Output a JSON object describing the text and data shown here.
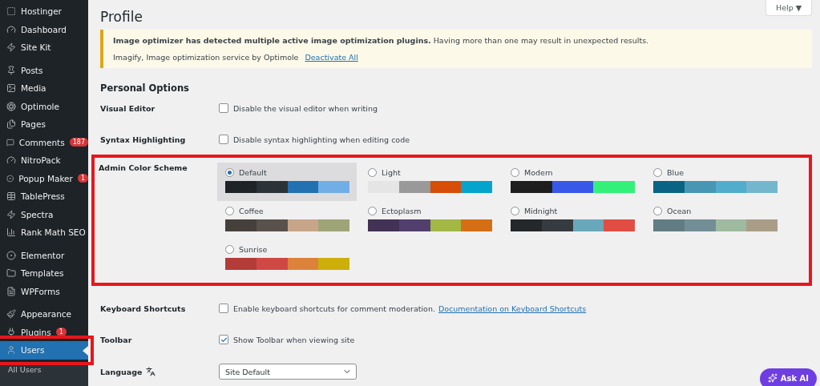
{
  "sidebar": {
    "groups": [
      {
        "items": [
          {
            "label": "Hostinger",
            "selected": false
          },
          {
            "label": "Dashboard",
            "selected": false
          },
          {
            "label": "Site Kit",
            "selected": false
          }
        ]
      },
      {
        "items": [
          {
            "label": "Posts",
            "selected": false
          },
          {
            "label": "Media",
            "selected": false
          },
          {
            "label": "Optimole",
            "selected": false
          },
          {
            "label": "Pages",
            "selected": false
          },
          {
            "label": "Comments",
            "badge": "187",
            "selected": false
          },
          {
            "label": "NitroPack",
            "selected": false
          },
          {
            "label": "Popup Maker",
            "badge": "1",
            "selected": false
          },
          {
            "label": "TablePress",
            "selected": false
          },
          {
            "label": "Spectra",
            "selected": false
          },
          {
            "label": "Rank Math SEO",
            "selected": false
          }
        ]
      },
      {
        "items": [
          {
            "label": "Elementor",
            "selected": false
          },
          {
            "label": "Templates",
            "selected": false
          },
          {
            "label": "WPForms",
            "selected": false
          }
        ]
      },
      {
        "items": [
          {
            "label": "Appearance",
            "selected": false
          },
          {
            "label": "Plugins",
            "badge": "1",
            "selected": false
          },
          {
            "label": "Users",
            "selected": true,
            "highlighted": true
          }
        ]
      }
    ],
    "submenu": [
      "All Users"
    ]
  },
  "page": {
    "title": "Profile",
    "help": "Help ▼",
    "notice": {
      "bold": "Image optimizer has detected multiple active image optimization plugins.",
      "text": " Having more than one may result in unexpected results.",
      "plugins": "Imagify, Image optimization service by Optimole",
      "link": "Deactivate All"
    },
    "section": "Personal Options",
    "rows": [
      {
        "kind": "checkbox",
        "label": "Visual Editor",
        "text": "Disable the visual editor when writing",
        "checked": false
      },
      {
        "kind": "checkbox",
        "label": "Syntax Highlighting",
        "text": "Disable syntax highlighting when editing code",
        "checked": false
      },
      {
        "kind": "schemes",
        "label": "Admin Color Scheme",
        "highlighted": true,
        "schemes": [
          {
            "name": "Default",
            "selected": true,
            "colors": [
              {
                "color": "#1d2327"
              },
              {
                "color": "#2c3338"
              },
              {
                "color": "#2271b1"
              },
              {
                "color": "#72aee6"
              }
            ]
          },
          {
            "name": "Light",
            "selected": false,
            "colors": [
              {
                "color": "#e5e5e5"
              },
              {
                "color": "#999999"
              },
              {
                "color": "#d64e07"
              },
              {
                "color": "#04a4cc"
              }
            ]
          },
          {
            "name": "Modern",
            "selected": false,
            "colors": [
              {
                "color": "#1e1e1e"
              },
              {
                "color": "#3858e9"
              },
              {
                "color": "#33f078"
              }
            ]
          },
          {
            "name": "Blue",
            "selected": false,
            "colors": [
              {
                "color": "#096484"
              },
              {
                "color": "#4796b3"
              },
              {
                "color": "#52accc"
              },
              {
                "color": "#74b6ce"
              }
            ]
          },
          {
            "name": "Coffee",
            "selected": false,
            "colors": [
              {
                "color": "#46403c"
              },
              {
                "color": "#59524c"
              },
              {
                "color": "#c7a589"
              },
              {
                "color": "#9ea476"
              }
            ]
          },
          {
            "name": "Ectoplasm",
            "selected": false,
            "colors": [
              {
                "color": "#413256"
              },
              {
                "color": "#523f6d"
              },
              {
                "color": "#a3b745"
              },
              {
                "color": "#d46f15"
              }
            ]
          },
          {
            "name": "Midnight",
            "selected": false,
            "colors": [
              {
                "color": "#25282b"
              },
              {
                "color": "#363b3f"
              },
              {
                "color": "#69a8bb"
              },
              {
                "color": "#e14d43"
              }
            ]
          },
          {
            "name": "Ocean",
            "selected": false,
            "colors": [
              {
                "color": "#627c83"
              },
              {
                "color": "#738e96"
              },
              {
                "color": "#9ebaa0"
              },
              {
                "color": "#aa9d88"
              }
            ]
          },
          {
            "name": "Sunrise",
            "selected": false,
            "colors": [
              {
                "color": "#b43c38"
              },
              {
                "color": "#cf4944"
              },
              {
                "color": "#dd823b"
              },
              {
                "color": "#ccaf0b"
              }
            ]
          }
        ]
      },
      {
        "kind": "checkbox",
        "label": "Keyboard Shortcuts",
        "text": "Enable keyboard shortcuts for comment moderation.",
        "link": "Documentation on Keyboard Shortcuts",
        "checked": false
      },
      {
        "kind": "checkbox",
        "label": "Toolbar",
        "text": "Show Toolbar when viewing site",
        "checked": true
      },
      {
        "kind": "select",
        "label": "Language",
        "value": "Site Default"
      }
    ]
  },
  "ask_ai": "Ask AI"
}
